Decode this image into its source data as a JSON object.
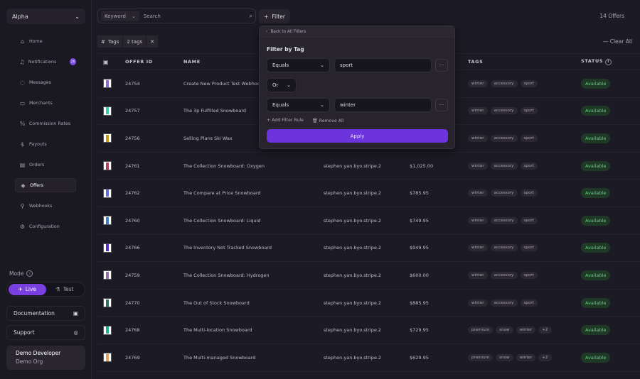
{
  "sidebar": {
    "org": "Alpha",
    "items": [
      {
        "label": "Home",
        "icon": "home-icon",
        "glyph": "⌂"
      },
      {
        "label": "Notifications",
        "icon": "bell-icon",
        "glyph": "♫",
        "badge": "26"
      },
      {
        "label": "Messages",
        "icon": "message-icon",
        "glyph": "◌"
      },
      {
        "label": "Merchants",
        "icon": "store-icon",
        "glyph": "▭"
      },
      {
        "label": "Commission Rates",
        "icon": "percent-icon",
        "glyph": "%"
      },
      {
        "label": "Payouts",
        "icon": "payout-icon",
        "glyph": "$"
      },
      {
        "label": "Orders",
        "icon": "orders-icon",
        "glyph": "▤"
      },
      {
        "label": "Offers",
        "icon": "tag-icon",
        "glyph": "◆",
        "active": true
      },
      {
        "label": "Webhooks",
        "icon": "webhook-icon",
        "glyph": "⚲"
      },
      {
        "label": "Configuration",
        "icon": "gear-icon",
        "glyph": "⚙"
      }
    ],
    "mode_label": "Mode",
    "live": "Live",
    "test": "Test",
    "documentation": "Documentation",
    "support": "Support",
    "user_name": "Demo Developer",
    "user_org": "Demo Org"
  },
  "toolbar": {
    "keyword": "Keyword",
    "search_placeholder": "Search",
    "filter": "Filter",
    "count": "14 Offers",
    "clear_all": "Clear All"
  },
  "chips": {
    "field": "Tags",
    "value": "2 tags"
  },
  "table": {
    "headers": [
      "",
      "OFFER ID",
      "NAME",
      "",
      "",
      "TAGS",
      "STATUS"
    ],
    "rows": [
      {
        "id": "24754",
        "name": "Create New Product Test Webhook",
        "merchant": "",
        "price": "",
        "tags": [
          "winter",
          "accessory",
          "sport"
        ],
        "status": "Available",
        "color": "#8a6ad0"
      },
      {
        "id": "24757",
        "name": "The 3p Fulfilled Snowboard",
        "merchant": "",
        "price": "",
        "tags": [
          "winter",
          "accessory",
          "sport"
        ],
        "status": "Available",
        "color": "#3ccaa8"
      },
      {
        "id": "24756",
        "name": "Selling Plans Ski Wax",
        "merchant": "",
        "price": "",
        "tags": [
          "winter",
          "accessory",
          "sport"
        ],
        "status": "Available",
        "color": "#c89a20"
      },
      {
        "id": "24761",
        "name": "The Collection Snowboard: Oxygen",
        "merchant": "stephen.yan.byo.stripe.2",
        "price": "$1,025.00",
        "tags": [
          "winter",
          "accessory",
          "sport"
        ],
        "status": "Available",
        "color": "#b04060"
      },
      {
        "id": "24762",
        "name": "The Compare at Price Snowboard",
        "merchant": "stephen.yan.byo.stripe.2",
        "price": "$785.95",
        "tags": [
          "winter",
          "accessory",
          "sport"
        ],
        "status": "Available",
        "color": "#6070d0"
      },
      {
        "id": "24760",
        "name": "The Collection Snowboard: Liquid",
        "merchant": "stephen.yan.byo.stripe.2",
        "price": "$749.95",
        "tags": [
          "winter",
          "accessory",
          "sport"
        ],
        "status": "Available",
        "color": "#4080c0"
      },
      {
        "id": "24766",
        "name": "The Inventory Not Tracked Snowboard",
        "merchant": "stephen.yan.byo.stripe.2",
        "price": "$949.95",
        "tags": [
          "winter",
          "accessory",
          "sport"
        ],
        "status": "Available",
        "color": "#5030c0"
      },
      {
        "id": "24759",
        "name": "The Collection Snowboard: Hydrogen",
        "merchant": "stephen.yan.byo.stripe.2",
        "price": "$600.00",
        "tags": [
          "winter",
          "accessory",
          "sport"
        ],
        "status": "Available",
        "color": "#9070a0"
      },
      {
        "id": "24770",
        "name": "The Out of Stock Snowboard",
        "merchant": "stephen.yan.byo.stripe.2",
        "price": "$885.95",
        "tags": [
          "winter",
          "accessory",
          "sport"
        ],
        "status": "Available",
        "color": "#307060"
      },
      {
        "id": "24768",
        "name": "The Multi-location Snowboard",
        "merchant": "stephen.yan.byo.stripe.2",
        "price": "$729.95",
        "tags": [
          "premium",
          "snow",
          "winter",
          "+2"
        ],
        "status": "Available",
        "color": "#20b090"
      },
      {
        "id": "24769",
        "name": "The Multi-managed Snowboard",
        "merchant": "stephen.yan.byo.stripe.2",
        "price": "$629.95",
        "tags": [
          "premium",
          "snow",
          "winter",
          "+2"
        ],
        "status": "Available",
        "color": "#e0a060"
      }
    ]
  },
  "popover": {
    "back": "Back to All Filters",
    "title": "Filter by Tag",
    "rule1_op": "Equals",
    "rule1_value": "sport",
    "joiner": "Or",
    "rule2_op": "Equals",
    "rule2_value": "winter",
    "add_rule": "Add Filter Rule",
    "remove_all": "Remove All",
    "apply": "Apply"
  },
  "colors": {
    "accent": "#6d33dc",
    "status_green": "#5fd07e"
  }
}
